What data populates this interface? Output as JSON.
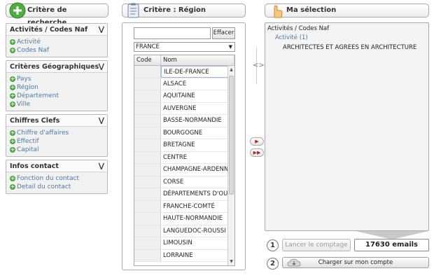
{
  "headers": {
    "search": "Critère de recherche",
    "criteria": "Critère : Région",
    "selection": "Ma sélection"
  },
  "sections": [
    {
      "title": "Activités / Codes Naf",
      "items": [
        "Activité",
        "Codes Naf"
      ]
    },
    {
      "title": "Critères Géographiques",
      "items": [
        "Pays",
        "Région",
        "Département",
        "Ville"
      ]
    },
    {
      "title": "Chiffres Clefs",
      "items": [
        "Chiffre d'affaires",
        "Effectif",
        "Capital"
      ]
    },
    {
      "title": "Infos contact",
      "items": [
        "Fonction du contact",
        "Detail du contact"
      ]
    }
  ],
  "search": {
    "value": "",
    "clear_label": "Effacer"
  },
  "country": {
    "selected": "FRANCE"
  },
  "table": {
    "columns": [
      "Code",
      "Nom"
    ],
    "rows": [
      "ILE-DE-FRANCE",
      "ALSACE",
      "AQUITAINE",
      "AUVERGNE",
      "BASSE-NORMANDIE",
      "BOURGOGNE",
      "BRETAGNE",
      "CENTRE",
      "CHAMPAGNE-ARDENN",
      "CORSE",
      "DÉPARTEMENTS D'OU",
      "FRANCHE-COMTÉ",
      "HAUTE-NORMANDIE",
      "LANGUEDOC-ROUSSI",
      "LIMOUSIN",
      "LORRAINE"
    ]
  },
  "selection": {
    "category": "Activités / Codes Naf",
    "subcategory": "Activité (1)",
    "value": "ARCHITECTES ET AGREES EN ARCHITECTURE"
  },
  "actions": {
    "step1": "1",
    "count_label": "Lancer le comptage",
    "emails": "17630 emails",
    "step2": "2",
    "load_label": "Charger sur mon compte"
  },
  "colors": {
    "link": "#4a7ab0",
    "plus": "#47a73b",
    "arrow": "#c0211f"
  }
}
